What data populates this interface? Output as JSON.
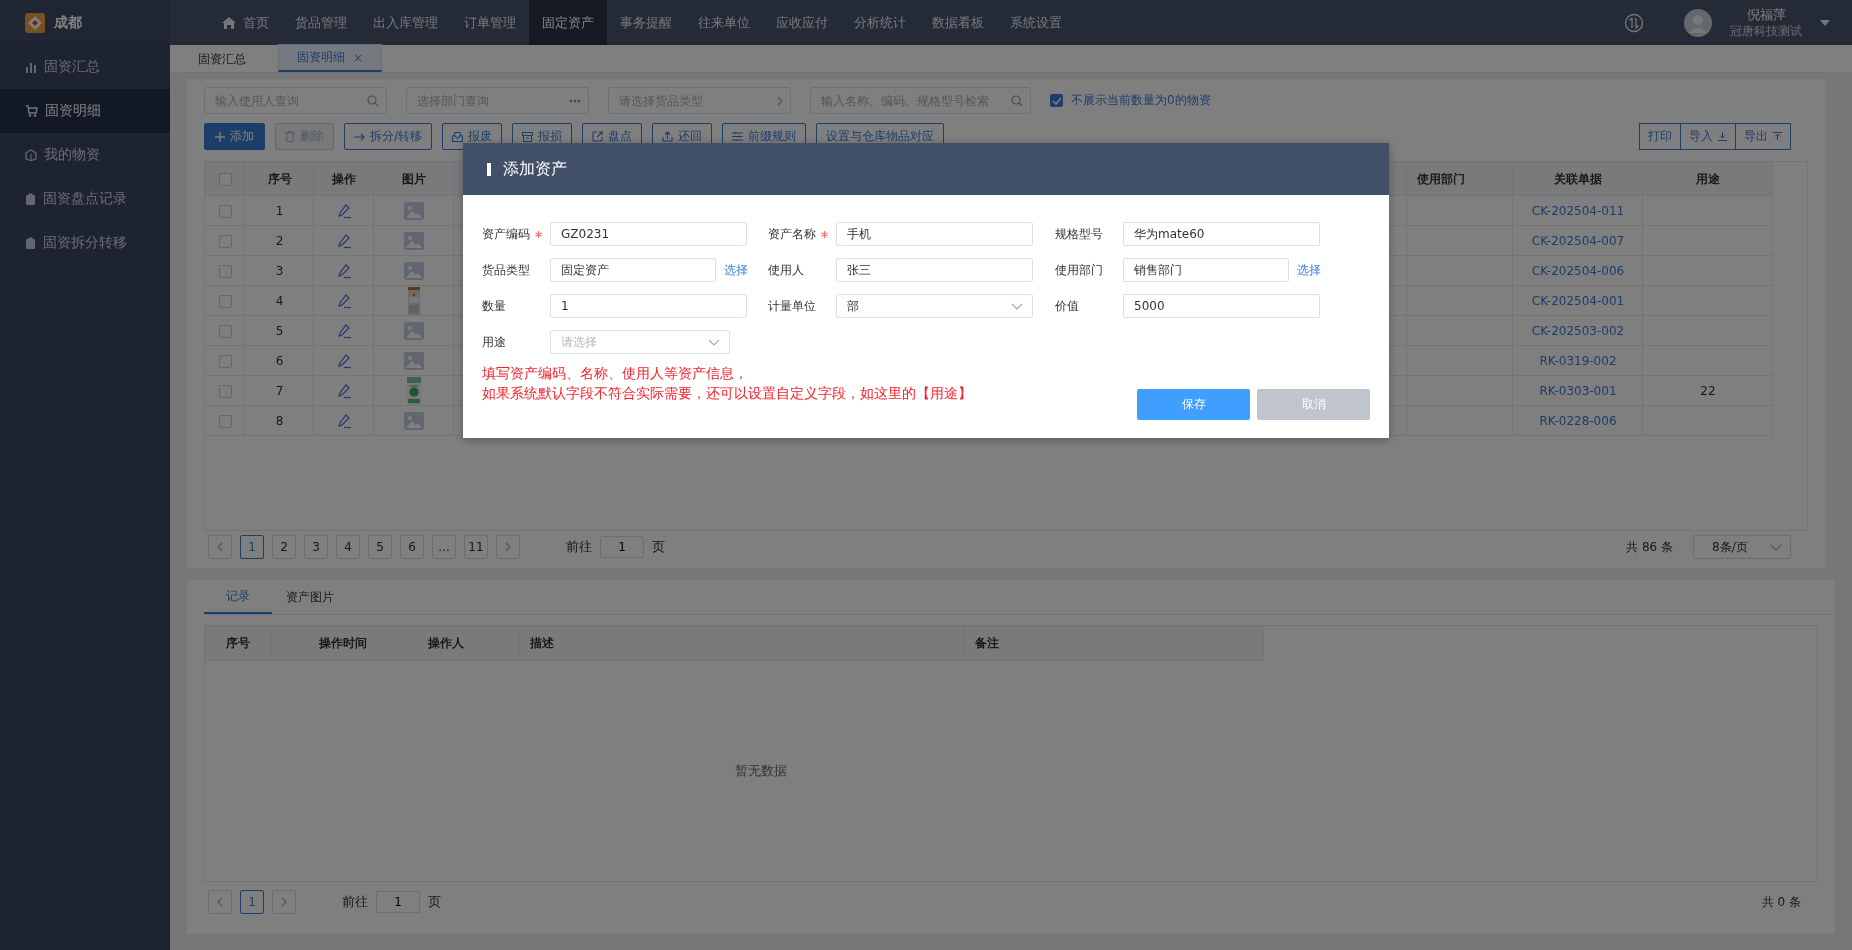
{
  "app": {
    "city": "成都"
  },
  "top_nav": [
    {
      "label": "首页",
      "selected": false
    },
    {
      "label": "货品管理",
      "selected": false
    },
    {
      "label": "出入库管理",
      "selected": false
    },
    {
      "label": "订单管理",
      "selected": false
    },
    {
      "label": "固定资产",
      "selected": true
    },
    {
      "label": "事务提醒",
      "selected": false
    },
    {
      "label": "往来单位",
      "selected": false
    },
    {
      "label": "应收应付",
      "selected": false
    },
    {
      "label": "分析统计",
      "selected": false
    },
    {
      "label": "数据看板",
      "selected": false
    },
    {
      "label": "系统设置",
      "selected": false
    }
  ],
  "user": {
    "name": "倪福萍",
    "company": "冠唐科技测试"
  },
  "sidebar": {
    "items": [
      {
        "label": "固资汇总",
        "selected": false
      },
      {
        "label": "固资明细",
        "selected": true
      },
      {
        "label": "我的物资",
        "selected": false
      },
      {
        "label": "固资盘点记录",
        "selected": false
      },
      {
        "label": "固资拆分转移",
        "selected": false
      }
    ]
  },
  "page_tabs": [
    {
      "label": "固资汇总",
      "selected": false
    },
    {
      "label": "固资明细",
      "selected": true,
      "close": "×"
    }
  ],
  "filters": [
    {
      "placeholder": "输入使用人查询",
      "kind": "search"
    },
    {
      "placeholder": "选择部门查询",
      "kind": "more"
    },
    {
      "placeholder": "请选择货品类型",
      "kind": "arrow"
    },
    {
      "placeholder": "输入名称、编码、规格型号检索",
      "kind": "search"
    }
  ],
  "hide_zero": {
    "label": "不展示当前数量为0的物资",
    "checked": true
  },
  "toolbar": [
    {
      "label": "添加",
      "kind": "primary",
      "disabled": false
    },
    {
      "label": "删除",
      "kind": "default",
      "disabled": true
    },
    {
      "label": "拆分/转移",
      "kind": "default",
      "disabled": false
    },
    {
      "label": "报废",
      "kind": "default",
      "disabled": false
    },
    {
      "label": "报损",
      "kind": "default",
      "disabled": false
    },
    {
      "label": "盘点",
      "kind": "default",
      "disabled": false
    },
    {
      "label": "还回",
      "kind": "default",
      "disabled": false
    },
    {
      "label": "前缀规则",
      "kind": "default",
      "disabled": false
    },
    {
      "label": "设置与仓库物品对应",
      "kind": "default",
      "disabled": false
    }
  ],
  "toolbar_right": [
    {
      "label": "打印"
    },
    {
      "label": "导入"
    },
    {
      "label": "导出"
    }
  ],
  "table": {
    "all_checked": false,
    "columns_left": [
      "序号",
      "操作",
      "图片"
    ],
    "columns_right": [
      "使用部门",
      "关联单据",
      "用途"
    ],
    "rows": [
      {
        "checked": false,
        "no": "1",
        "kind": "placeholder",
        "doc": "CK-202504-011"
      },
      {
        "checked": false,
        "no": "2",
        "kind": "placeholder",
        "doc": "CK-202504-007"
      },
      {
        "checked": false,
        "no": "3",
        "kind": "placeholder",
        "doc": "CK-202504-006"
      },
      {
        "checked": false,
        "no": "4",
        "kind": "picture",
        "doc": "CK-202504-001"
      },
      {
        "checked": false,
        "no": "5",
        "kind": "placeholder",
        "doc": "CK-202503-002"
      },
      {
        "checked": false,
        "no": "6",
        "kind": "placeholder",
        "doc": "RK-0319-002"
      },
      {
        "checked": false,
        "no": "7",
        "kind": "picture",
        "doc": "RK-0303-001",
        "use": "22"
      },
      {
        "checked": false,
        "no": "8",
        "kind": "placeholder",
        "doc": "RK-0228-006"
      }
    ]
  },
  "pagination": {
    "pages": [
      {
        "label": "1",
        "selected": true
      },
      {
        "label": "2",
        "selected": false
      },
      {
        "label": "3",
        "selected": false
      },
      {
        "label": "4",
        "selected": false
      },
      {
        "label": "5",
        "selected": false
      },
      {
        "label": "6",
        "selected": false
      },
      {
        "label": "...",
        "selected": false
      },
      {
        "label": "11",
        "selected": false
      }
    ],
    "goto_label": "前往",
    "goto_value": "1",
    "page_unit": "页",
    "total": "共 86 条",
    "page_size": "8条/页"
  },
  "detail_tabs": [
    {
      "label": "记录",
      "selected": true
    },
    {
      "label": "资产图片",
      "selected": false
    }
  ],
  "records": {
    "columns": [
      "序号",
      "操作时间",
      "操作人",
      "描述",
      "备注"
    ],
    "empty": "暂无数据"
  },
  "records_pagination": {
    "pages": [
      {
        "label": "1",
        "selected": true
      }
    ],
    "goto_label": "前往",
    "goto_value": "1",
    "page_unit": "页",
    "total": "共 0 条"
  },
  "dialog": {
    "title": "添加资产",
    "fields": [
      {
        "label": "资产编码",
        "required": true,
        "kind": "text",
        "value": "GZ0231"
      },
      {
        "label": "资产名称",
        "required": true,
        "kind": "text",
        "value": "手机"
      },
      {
        "label": "规格型号",
        "required": false,
        "kind": "text",
        "value": "华为mate60"
      },
      {
        "label": "货品类型",
        "required": false,
        "kind": "text",
        "value": "固定资产",
        "link": "选择"
      },
      {
        "label": "使用人",
        "required": false,
        "kind": "text",
        "value": "张三"
      },
      {
        "label": "使用部门",
        "required": false,
        "kind": "text",
        "value": "销售部门",
        "link": "选择"
      },
      {
        "label": "数量",
        "required": false,
        "kind": "text",
        "value": "1"
      },
      {
        "label": "计量单位",
        "required": false,
        "kind": "select",
        "value": "部"
      },
      {
        "label": "价值",
        "required": false,
        "kind": "text",
        "value": "5000"
      },
      {
        "label": "用途",
        "required": false,
        "kind": "select",
        "placeholder": "请选择"
      }
    ],
    "note": [
      "填写资产编码、名称、使用人等资产信息，",
      "如果系统默认字段不符合实际需要，还可以设置自定义字段，如这里的【用途】"
    ],
    "buttons": [
      {
        "label": "保存",
        "kind": "primary"
      },
      {
        "label": "取消",
        "kind": "secondary"
      }
    ]
  }
}
